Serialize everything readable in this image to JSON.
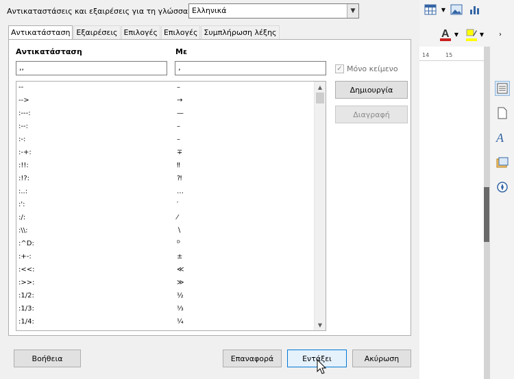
{
  "dialog": {
    "language_label": "Αντικαταστάσεις και εξαιρέσεις για τη γλώσσα:",
    "language_value": "Ελληνικά",
    "tabs": [
      {
        "label": "Αντικατάσταση",
        "active": true
      },
      {
        "label": "Εξαιρέσεις",
        "active": false
      },
      {
        "label": "Επιλογές",
        "active": false
      },
      {
        "label": "Επιλογές",
        "active": false
      },
      {
        "label": "Συμπλήρωση λέξης",
        "active": false
      }
    ],
    "col_replace": "Αντικατάσταση",
    "col_with": "Με",
    "replace_value": ",,",
    "with_value": "‚",
    "text_only_label": "Μόνο κείμενο",
    "text_only_checked": true,
    "new_button": "Δημιουργία",
    "delete_button": "Διαγραφή",
    "rows": [
      {
        "a": "--",
        "b": "–"
      },
      {
        "a": "-->",
        "b": "→"
      },
      {
        "a": ":---:",
        "b": "—"
      },
      {
        "a": ":--:",
        "b": "–"
      },
      {
        "a": ":-:",
        "b": "–"
      },
      {
        "a": ":-+:",
        "b": "∓"
      },
      {
        "a": ":!!:",
        "b": "‼"
      },
      {
        "a": ":!?:",
        "b": "⁈"
      },
      {
        "a": ":..:",
        "b": "…"
      },
      {
        "a": ":':",
        "b": "′"
      },
      {
        "a": ":/:",
        "b": "⁄"
      },
      {
        "a": ":\\\\:",
        "b": "∖"
      },
      {
        "a": ":^D:",
        "b": "ᴰ"
      },
      {
        "a": ":+-:",
        "b": "±"
      },
      {
        "a": ":<<:",
        "b": "≪"
      },
      {
        "a": ":>>:",
        "b": "≫"
      },
      {
        "a": ":1/2:",
        "b": "½"
      },
      {
        "a": ":1/3:",
        "b": "⅓"
      },
      {
        "a": ":1/4:",
        "b": "¼"
      }
    ],
    "help_button": "Βοήθεια",
    "reset_button": "Επαναφορά",
    "ok_button": "Εντάξει",
    "cancel_button": "Ακύρωση"
  },
  "ruler": {
    "mark_1": "14",
    "mark_2": "15"
  },
  "colors": {
    "font_color": "#c9211e",
    "highlight": "#ffff00",
    "accent": "#0078d7"
  }
}
